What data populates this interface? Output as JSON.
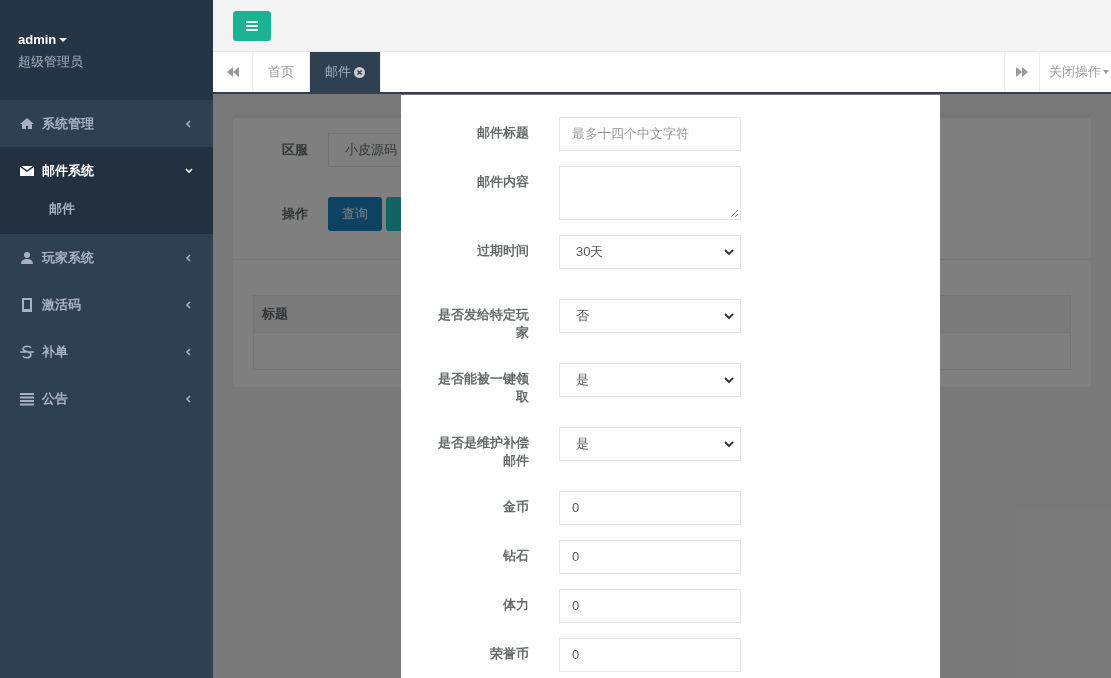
{
  "user": {
    "name": "admin",
    "role": "超级管理员"
  },
  "sidebar": {
    "items": [
      {
        "label": "系统管理",
        "expanded": false
      },
      {
        "label": "邮件系统",
        "expanded": true,
        "children": [
          {
            "label": "邮件"
          }
        ]
      },
      {
        "label": "玩家系统",
        "expanded": false
      },
      {
        "label": "激活码",
        "expanded": false
      },
      {
        "label": "补单",
        "expanded": false
      },
      {
        "label": "公告",
        "expanded": false
      }
    ]
  },
  "tabs": [
    {
      "label": "首页",
      "selected": false,
      "closable": false
    },
    {
      "label": "邮件",
      "selected": true,
      "closable": true
    }
  ],
  "close_menu": {
    "label": "关闭操作"
  },
  "filter": {
    "server_label": "区服",
    "server_value": "小皮源码",
    "action_label": "操作",
    "query_button": "查询"
  },
  "table": {
    "columns": [
      "标题"
    ]
  },
  "modal": {
    "fields": [
      {
        "kind": "input",
        "label": "邮件标题",
        "placeholder": "最多十四个中文字符"
      },
      {
        "kind": "textarea",
        "label": "邮件内容"
      },
      {
        "kind": "select",
        "label": "过期时间",
        "value": "30天"
      },
      {
        "kind": "select",
        "label": "是否发给特定玩家",
        "value": "否"
      },
      {
        "kind": "select",
        "label": "是否能被一键领取",
        "value": "是"
      },
      {
        "kind": "select",
        "label": "是否是维护补偿邮件",
        "value": "是"
      },
      {
        "kind": "input",
        "label": "金币",
        "value": "0"
      },
      {
        "kind": "input",
        "label": "钻石",
        "value": "0"
      },
      {
        "kind": "input",
        "label": "体力",
        "value": "0"
      },
      {
        "kind": "input",
        "label": "荣誉币",
        "value": "0"
      }
    ]
  }
}
